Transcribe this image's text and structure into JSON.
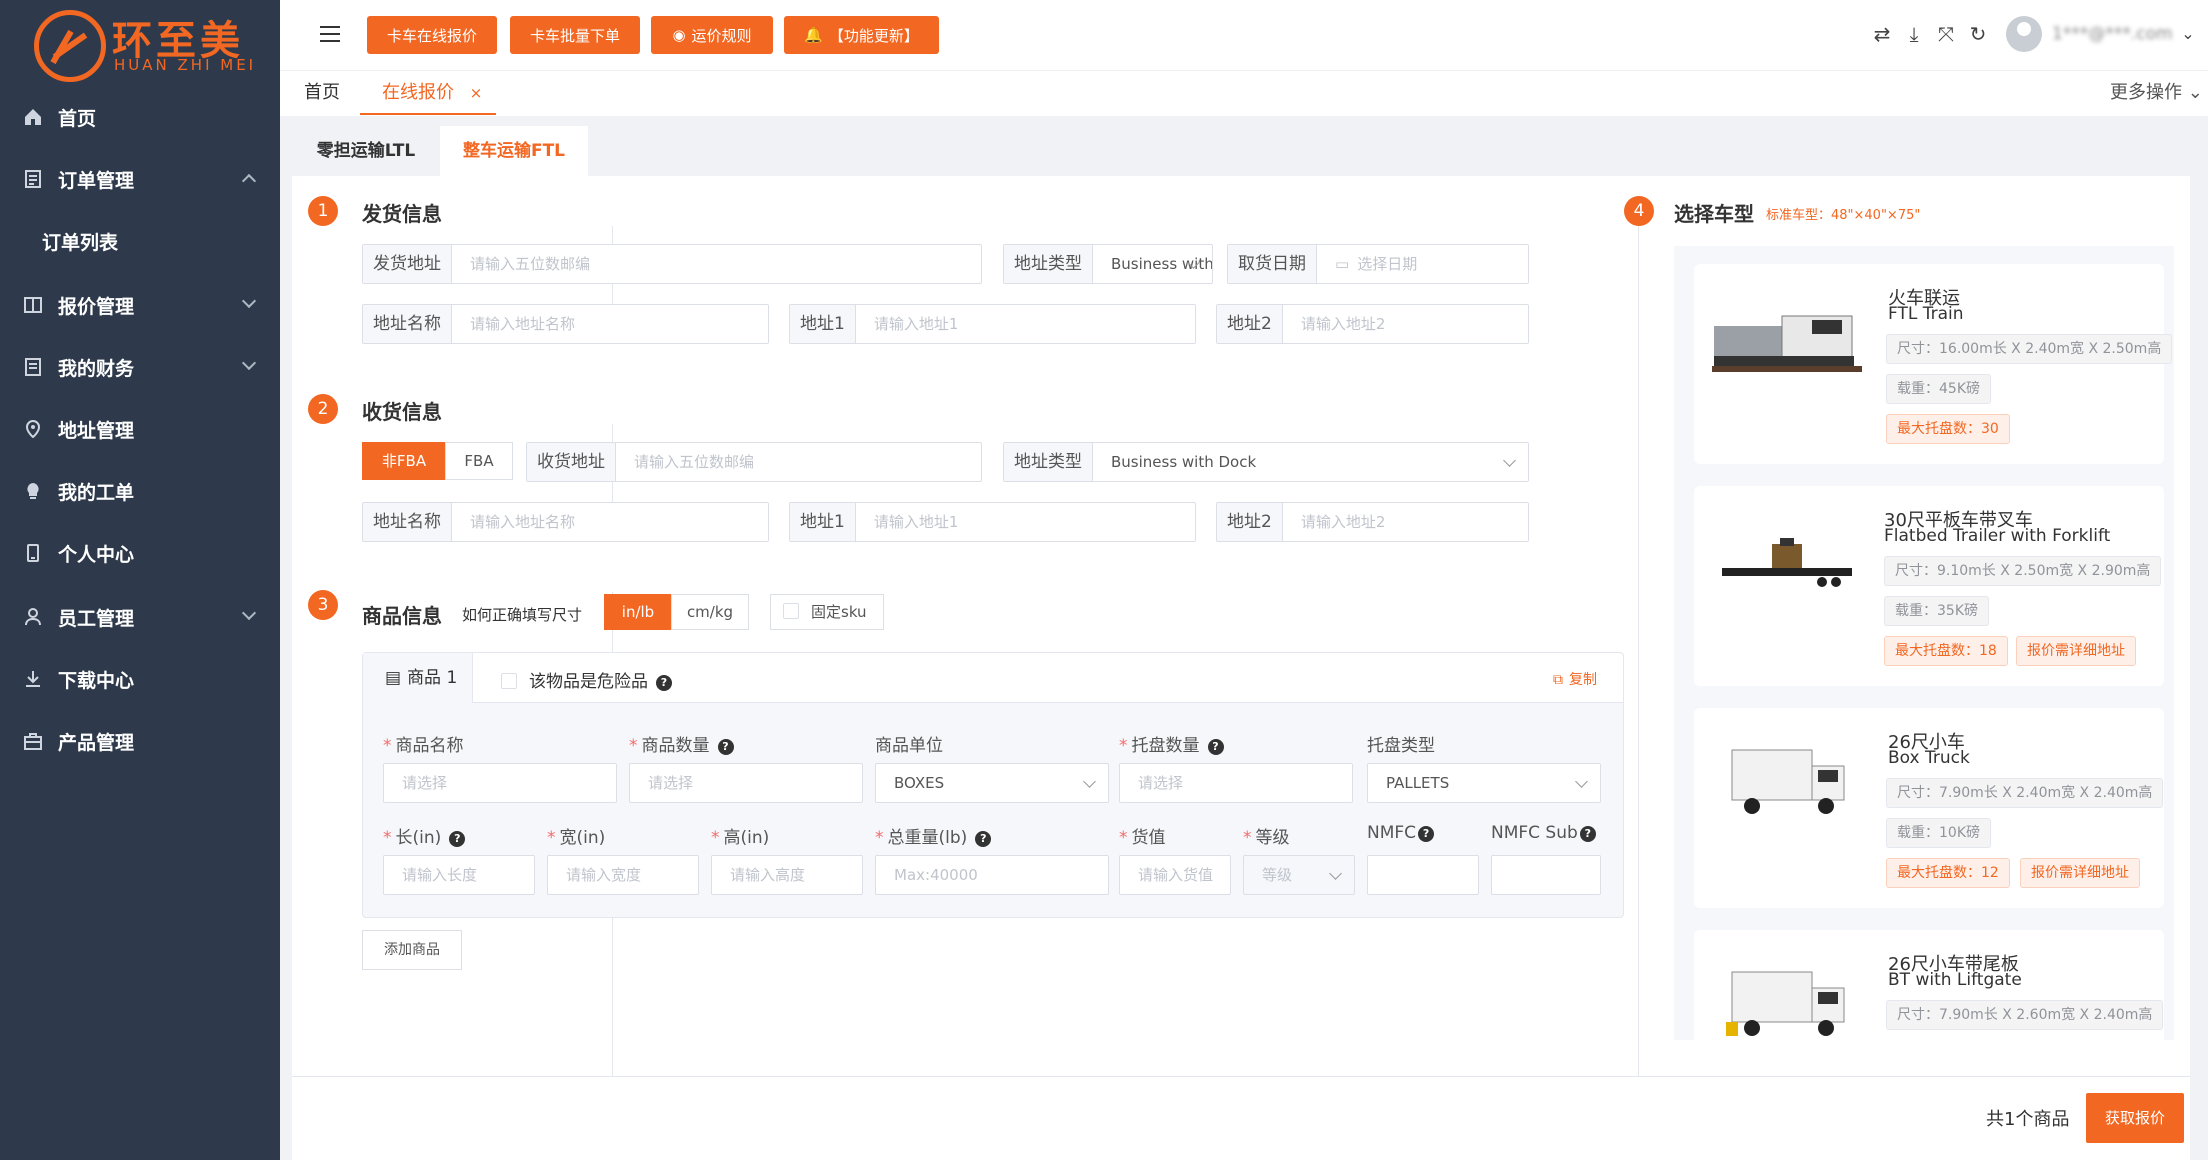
{
  "sidebar": {
    "logo_cn": "环至美",
    "logo_en": "HUAN ZHI MEI",
    "items": [
      {
        "label": "首页"
      },
      {
        "label": "订单管理"
      },
      {
        "label": "订单列表"
      },
      {
        "label": "报价管理"
      },
      {
        "label": "我的财务"
      },
      {
        "label": "地址管理"
      },
      {
        "label": "我的工单"
      },
      {
        "label": "个人中心"
      },
      {
        "label": "员工管理"
      },
      {
        "label": "下载中心"
      },
      {
        "label": "产品管理"
      }
    ]
  },
  "topbar": {
    "buttons": [
      "卡车在线报价",
      "卡车批量下单",
      "运价规则",
      "【功能更新】"
    ],
    "username": "1***@***.com"
  },
  "tabs": {
    "home": "首页",
    "active": "在线报价",
    "close": "×",
    "more": "更多操作"
  },
  "subtabs": [
    "零担运输LTL",
    "整车运输FTL"
  ],
  "ship": {
    "num": "1",
    "title": "发货信息",
    "addr_label": "发货地址",
    "addr_ph": "请输入五位数邮编",
    "type_label": "地址类型",
    "type_val": "Business with Dock",
    "date_label": "取货日期",
    "date_ph": "选择日期",
    "name_label": "地址名称",
    "name_ph": "请输入地址名称",
    "a1_label": "地址1",
    "a1_ph": "请输入地址1",
    "a2_label": "地址2",
    "a2_ph": "请输入地址2"
  },
  "recv": {
    "num": "2",
    "title": "收货信息",
    "seg": [
      "非FBA",
      "FBA"
    ],
    "addr_label": "收货地址",
    "addr_ph": "请输入五位数邮编",
    "type_label": "地址类型",
    "type_val": "Business with Dock",
    "name_label": "地址名称",
    "name_ph": "请输入地址名称",
    "a1_label": "地址1",
    "a1_ph": "请输入地址1",
    "a2_label": "地址2",
    "a2_ph": "请输入地址2"
  },
  "goods": {
    "num": "3",
    "title": "商品信息",
    "hint": "如何正确填写尺寸",
    "units": [
      "in/lb",
      "cm/kg"
    ],
    "fixed_sku": "固定sku",
    "card_tab": "商品 1",
    "dangerous": "该物品是危险品",
    "copy": "复制",
    "labels": {
      "name": "商品名称",
      "qty": "商品数量",
      "unit": "商品单位",
      "pallet_qty": "托盘数量",
      "pallet_type": "托盘类型",
      "len": "长(in)",
      "wid": "宽(in)",
      "hei": "高(in)",
      "weight": "总重量(lb)",
      "value": "货值",
      "grade": "等级",
      "nmfc": "NMFC",
      "nmfc_sub": "NMFC Sub"
    },
    "ph": {
      "name": "请选择",
      "qty": "请选择",
      "unit": "BOXES",
      "pallet_qty": "请选择",
      "pallet_type": "PALLETS",
      "len": "请输入长度",
      "wid": "请输入宽度",
      "hei": "请输入高度",
      "weight": "Max:40000",
      "value": "请输入货值",
      "grade": "等级"
    },
    "add": "添加商品"
  },
  "vehicle": {
    "num": "4",
    "title": "选择车型",
    "hint": "标准车型：48\"×40\"×75\"",
    "trucks": [
      {
        "cn": "火车联运",
        "en": "FTL Train",
        "size": "尺寸：16.00m长 X 2.40m宽 X 2.50m高",
        "load": "载重：45K磅",
        "max": "最大托盘数：30"
      },
      {
        "cn": "30尺平板车带叉车",
        "en": "Flatbed Trailer with Forklift",
        "size": "尺寸：9.10m长 X 2.50m宽 X 2.90m高",
        "load": "载重：35K磅",
        "max": "最大托盘数：18",
        "extra": "报价需详细地址"
      },
      {
        "cn": "26尺小车",
        "en": "Box Truck",
        "size": "尺寸：7.90m长 X 2.40m宽 X 2.40m高",
        "load": "载重：10K磅",
        "max": "最大托盘数：12",
        "extra": "报价需详细地址"
      },
      {
        "cn": "26尺小车带尾板",
        "en": "BT with Liftgate",
        "size": "尺寸：7.90m长 X 2.60m宽 X 2.40m高"
      }
    ]
  },
  "footer": {
    "count": "共1个商品",
    "submit": "获取报价"
  },
  "colors": {
    "accent": "#f26722",
    "sidebar": "#2e3a4b"
  }
}
